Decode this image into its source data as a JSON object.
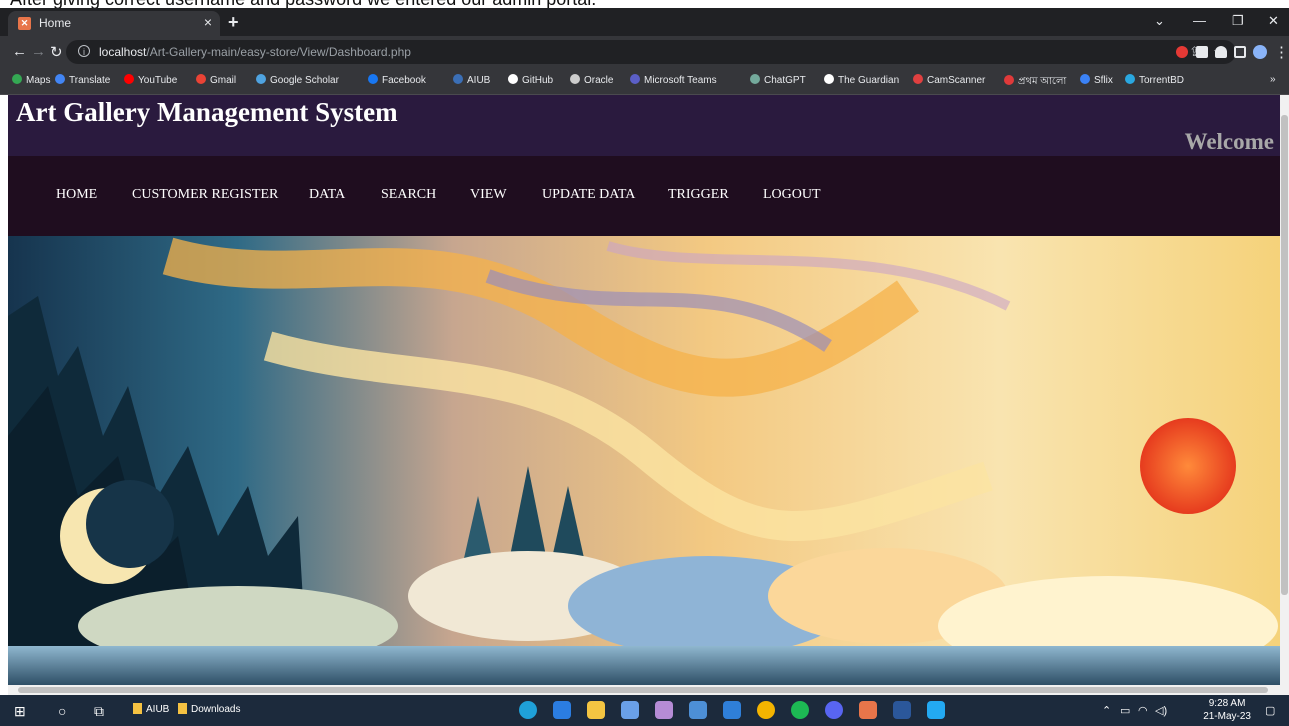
{
  "caption": "After giving correct username and password we entered our admin portal.",
  "browser": {
    "tab_title": "Home",
    "tab_close": "×",
    "new_tab": "+",
    "url_host": "localhost",
    "url_path": "/Art-Gallery-main/easy-store/View/Dashboard.php",
    "bookmarks": [
      "Maps",
      "Translate",
      "YouTube",
      "Gmail",
      "Google Scholar",
      "Facebook",
      "AIUB",
      "GitHub",
      "Oracle",
      "Microsoft Teams",
      "ChatGPT",
      "The Guardian",
      "CamScanner",
      "প্রথম আলো",
      "Sflix",
      "TorrentBD"
    ],
    "bookmark_colors": [
      "#34a853",
      "#4285f4",
      "#ff0000",
      "#ea4335",
      "#4fa3e0",
      "#1877f2",
      "#3b6fb6",
      "#ffffff",
      "#cccccc",
      "#5b5fc7",
      "#74aa9c",
      "#ffffff",
      "#e04040",
      "#e03a3a",
      "#3b82f6",
      "#2aa8e0"
    ],
    "bookmarks_more": "»"
  },
  "site": {
    "title": "Art Gallery Management System",
    "welcome": "Welcome",
    "nav": [
      "HOME",
      "CUSTOMER REGISTER",
      "DATA",
      "SEARCH",
      "VIEW",
      "UPDATE DATA",
      "TRIGGER",
      "LOGOUT"
    ]
  },
  "taskbar": {
    "folders": [
      "AIUB",
      "Downloads"
    ],
    "time": "9:28 AM",
    "date": "21-May-23"
  },
  "colors": {
    "header_bg": "#2a1a3e",
    "nav_bg": "#1f0d1f",
    "welcome_text": "#a8a8a8"
  }
}
